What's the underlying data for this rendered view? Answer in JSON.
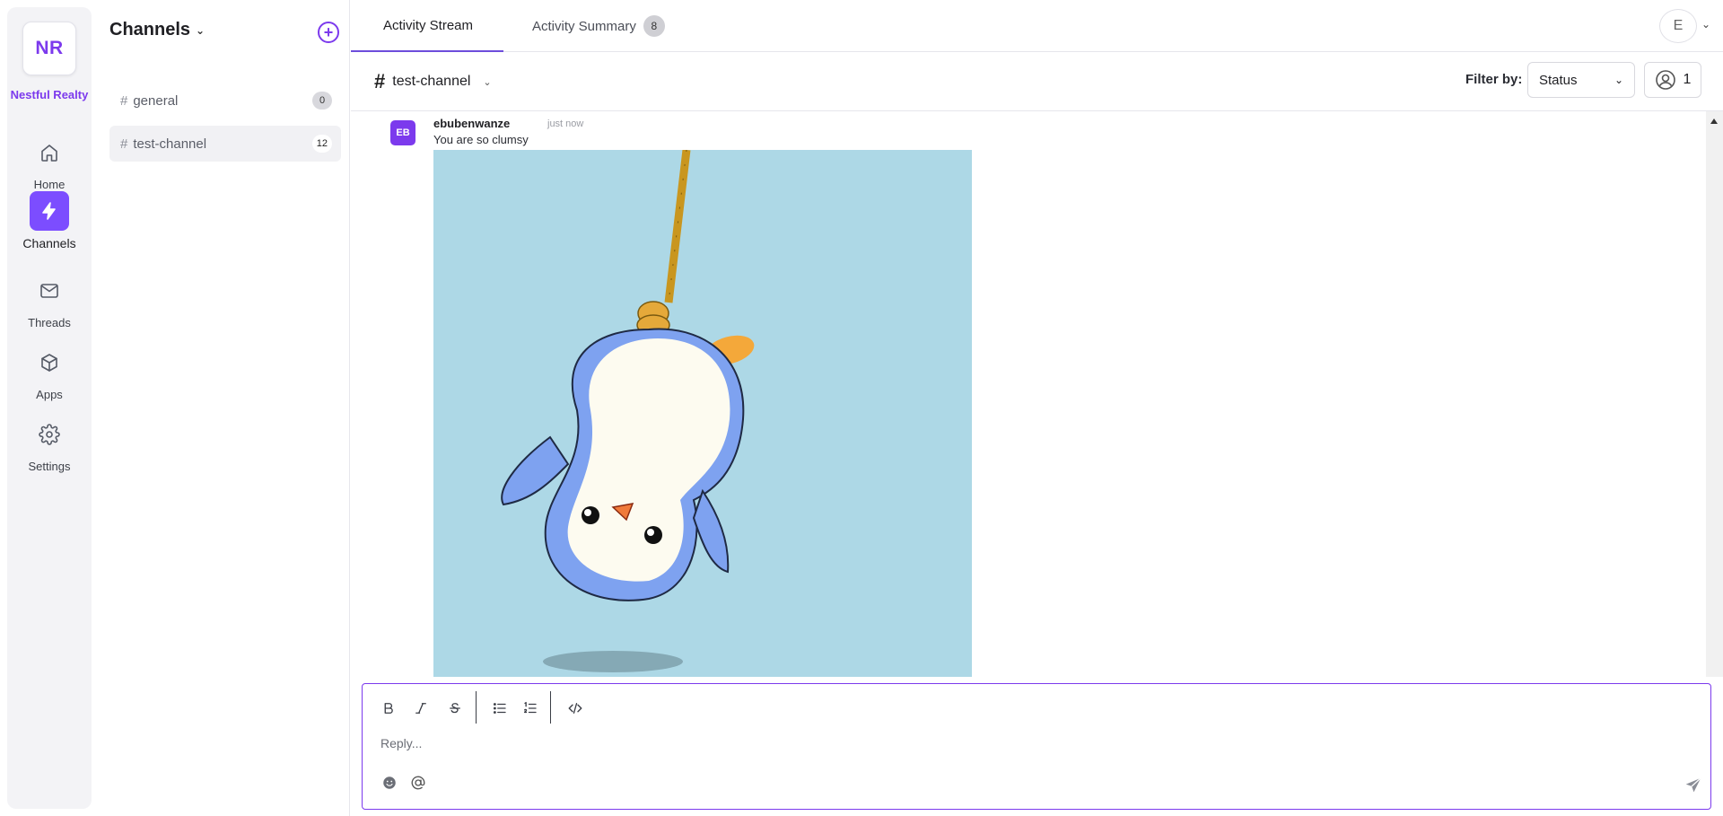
{
  "org": {
    "initials": "NR",
    "name": "Nestful Realty"
  },
  "nav": [
    {
      "label": "Home",
      "icon": "home-icon"
    },
    {
      "label": "Channels",
      "icon": "bolt-icon",
      "active": true
    },
    {
      "label": "Threads",
      "icon": "mail-icon"
    },
    {
      "label": "Apps",
      "icon": "box-icon"
    },
    {
      "label": "Settings",
      "icon": "gear-icon"
    }
  ],
  "channels_panel": {
    "title": "Channels",
    "items": [
      {
        "name": "general",
        "count": "0"
      },
      {
        "name": "test-channel",
        "count": "12",
        "active": true
      }
    ]
  },
  "tabs": [
    {
      "label": "Activity Stream",
      "active": true
    },
    {
      "label": "Activity Summary",
      "badge": "8"
    }
  ],
  "user": {
    "initial": "E"
  },
  "subheader": {
    "channel": "test-channel",
    "filter_label": "Filter by:",
    "filter_value": "Status",
    "member_count": "1"
  },
  "message": {
    "avatar": "EB",
    "author": "ebubenwanze",
    "time": "just now",
    "text": "You are so clumsy",
    "image_bg": "#add8e6"
  },
  "composer": {
    "placeholder": "Reply..."
  },
  "colors": {
    "accent": "#7c3aed",
    "nav_active": "#7c4dff"
  }
}
